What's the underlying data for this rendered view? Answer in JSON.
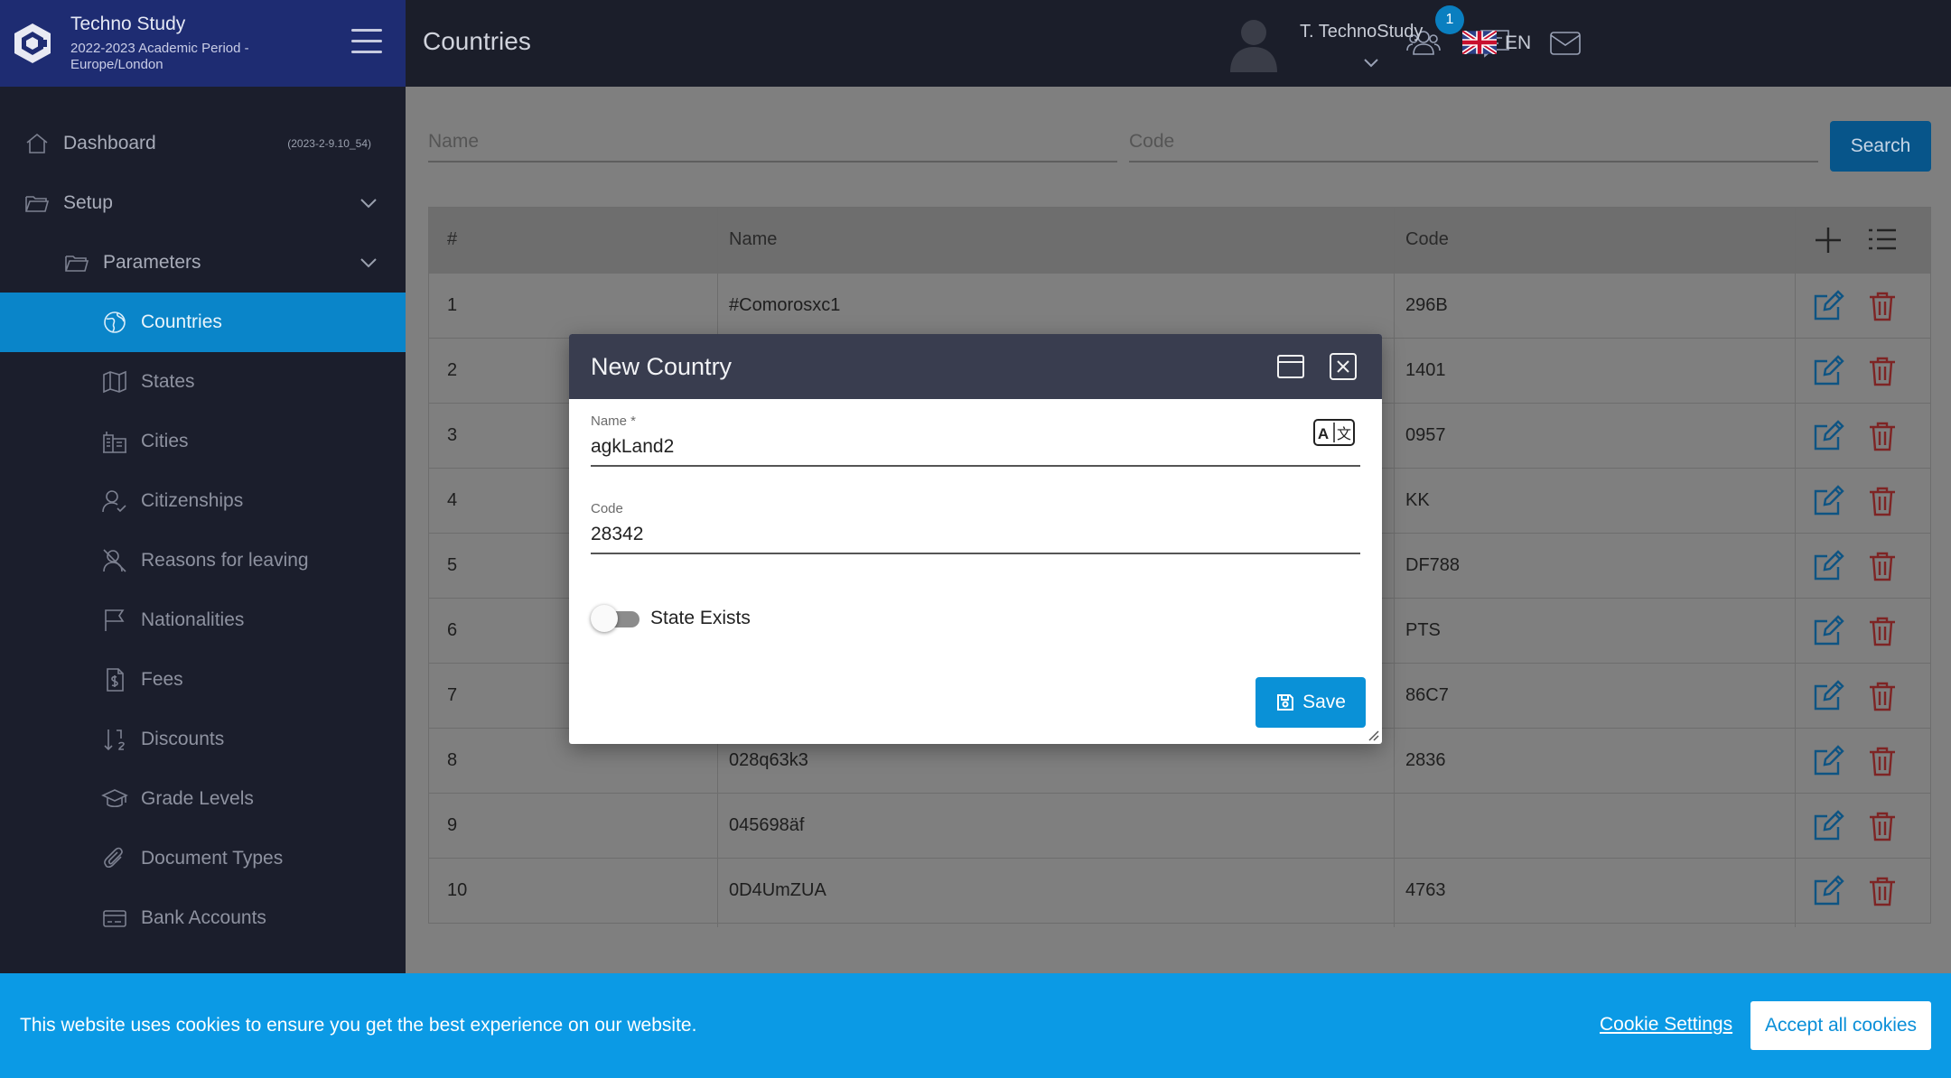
{
  "brand": {
    "title": "Techno Study",
    "subtitle": "2022-2023 Academic Period - Europe/London"
  },
  "sidebar": {
    "dashboard": {
      "label": "Dashboard",
      "meta": "(2023-2-9.10_54)"
    },
    "setup": {
      "label": "Setup"
    },
    "parameters": {
      "label": "Parameters"
    },
    "items": [
      {
        "label": "Countries",
        "icon": "globe-icon"
      },
      {
        "label": "States",
        "icon": "map-icon"
      },
      {
        "label": "Cities",
        "icon": "buildings-icon"
      },
      {
        "label": "Citizenships",
        "icon": "user-check-icon"
      },
      {
        "label": "Reasons for leaving",
        "icon": "user-x-icon"
      },
      {
        "label": "Nationalities",
        "icon": "flag-icon"
      },
      {
        "label": "Fees",
        "icon": "fee-icon"
      },
      {
        "label": "Discounts",
        "icon": "discount-icon"
      },
      {
        "label": "Grade Levels",
        "icon": "graduation-cap-icon"
      },
      {
        "label": "Document Types",
        "icon": "paperclip-icon"
      },
      {
        "label": "Bank Accounts",
        "icon": "bank-card-icon"
      }
    ]
  },
  "header": {
    "title": "Countries",
    "notification_count": "1",
    "user_name": "T. TechnoStudy",
    "language": "EN"
  },
  "search": {
    "name_placeholder": "Name",
    "code_placeholder": "Code",
    "button_label": "Search"
  },
  "table": {
    "headers": {
      "index": "#",
      "name": "Name",
      "code": "Code"
    },
    "rows": [
      {
        "index": "1",
        "name": "#Comorosxc1",
        "code": "296B"
      },
      {
        "index": "2",
        "name": "",
        "code": "1401"
      },
      {
        "index": "3",
        "name": "",
        "code": "0957"
      },
      {
        "index": "4",
        "name": "",
        "code": "KK"
      },
      {
        "index": "5",
        "name": "",
        "code": "DF788"
      },
      {
        "index": "6",
        "name": "",
        "code": "PTS"
      },
      {
        "index": "7",
        "name": "",
        "code": "86C7"
      },
      {
        "index": "8",
        "name": "028q63k3",
        "code": "2836"
      },
      {
        "index": "9",
        "name": "045698äf",
        "code": ""
      },
      {
        "index": "10",
        "name": "0D4UmZUA",
        "code": "4763"
      }
    ]
  },
  "dialog": {
    "title": "New Country",
    "name_label": "Name *",
    "name_value": "agkLand2",
    "code_label": "Code",
    "code_value": "28342",
    "toggle_label": "State Exists",
    "toggle_on": false,
    "save_label": "Save"
  },
  "cookie": {
    "text": "This website uses cookies to ensure you get the best experience on our website.",
    "settings_label": "Cookie Settings",
    "accept_label": "Accept all cookies"
  },
  "colors": {
    "sidebar_bg": "#1b1e2c",
    "brand_bg": "#1e2c72",
    "active_item": "#0a85c9",
    "primary": "#0a91d7",
    "delete": "#d32f2f",
    "cookie_bar": "#0b9ae5"
  }
}
